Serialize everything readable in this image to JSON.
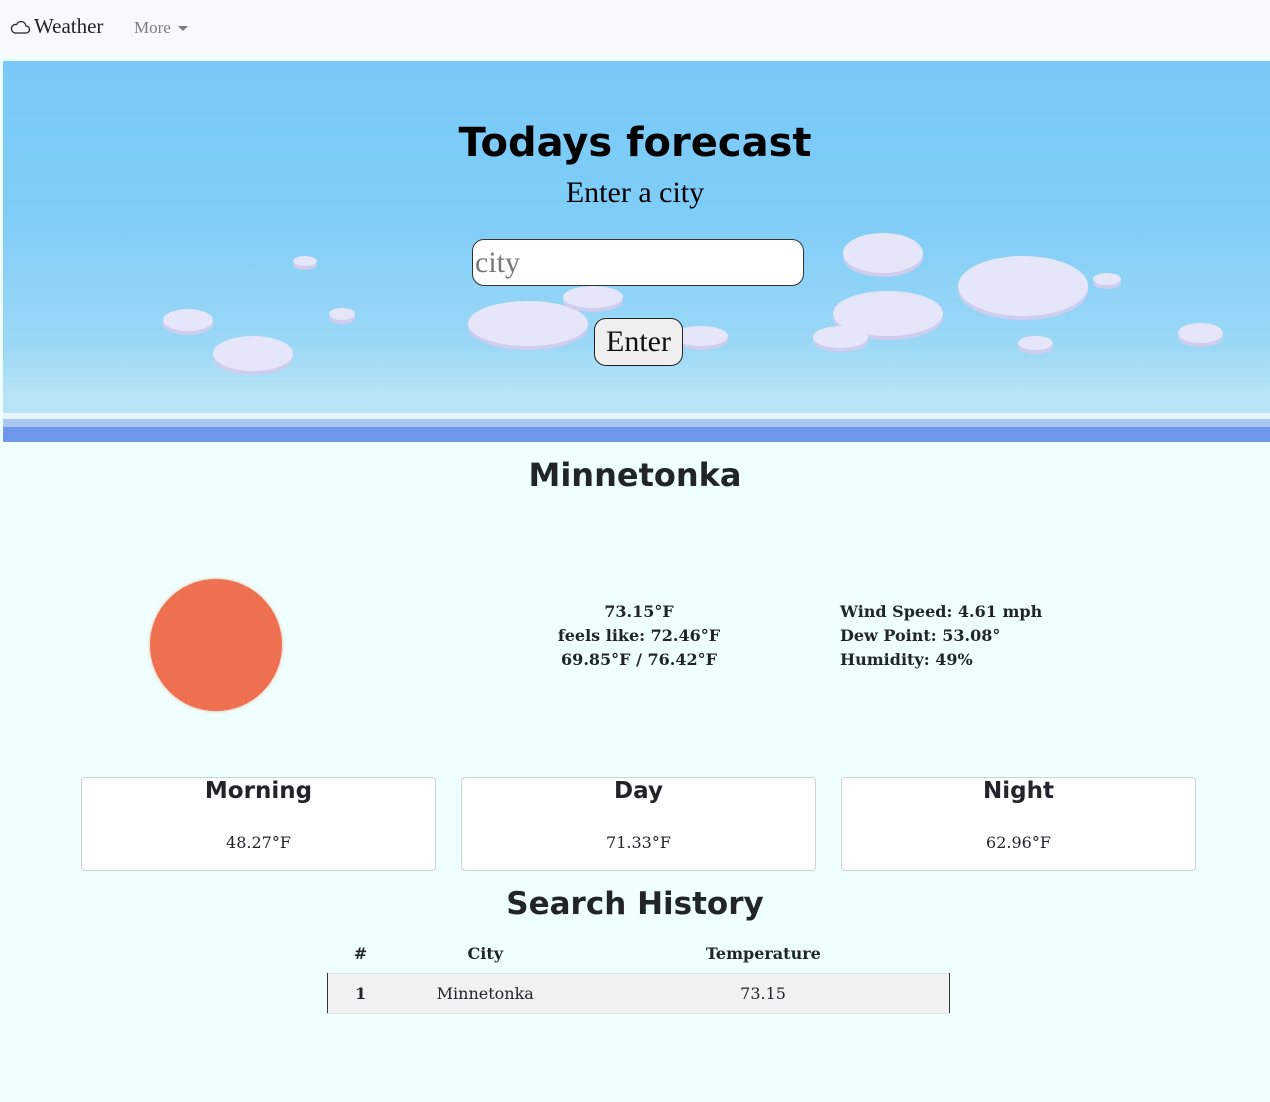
{
  "navbar": {
    "brand_icon": "cloud-icon",
    "brand": "Weather",
    "more_label": "More"
  },
  "hero": {
    "title": "Todays forecast",
    "subtitle": "Enter a city",
    "input_placeholder": "city",
    "input_value": "",
    "button_label": "Enter"
  },
  "current": {
    "city": "Minnetonka",
    "icon": "sun-icon",
    "icon_color": "#ef7050",
    "temperature": "73.15°F",
    "feels_like": "feels like: 72.46°F",
    "min_max": "69.85°F / 76.42°F",
    "wind_speed": "Wind Speed: 4.61 mph",
    "dew_point": "Dew Point: 53.08°",
    "humidity": "Humidity: 49%"
  },
  "periods": [
    {
      "label": "Morning",
      "temp": "48.27°F"
    },
    {
      "label": "Day",
      "temp": "71.33°F"
    },
    {
      "label": "Night",
      "temp": "62.96°F"
    }
  ],
  "history": {
    "title": "Search History",
    "columns": [
      "#",
      "City",
      "Temperature"
    ],
    "rows": [
      [
        "1",
        "Minnetonka",
        "73.15"
      ]
    ]
  },
  "colors": {
    "sky": "#78c9f7",
    "page_background": "#eefffe",
    "sun": "#ef7050"
  }
}
